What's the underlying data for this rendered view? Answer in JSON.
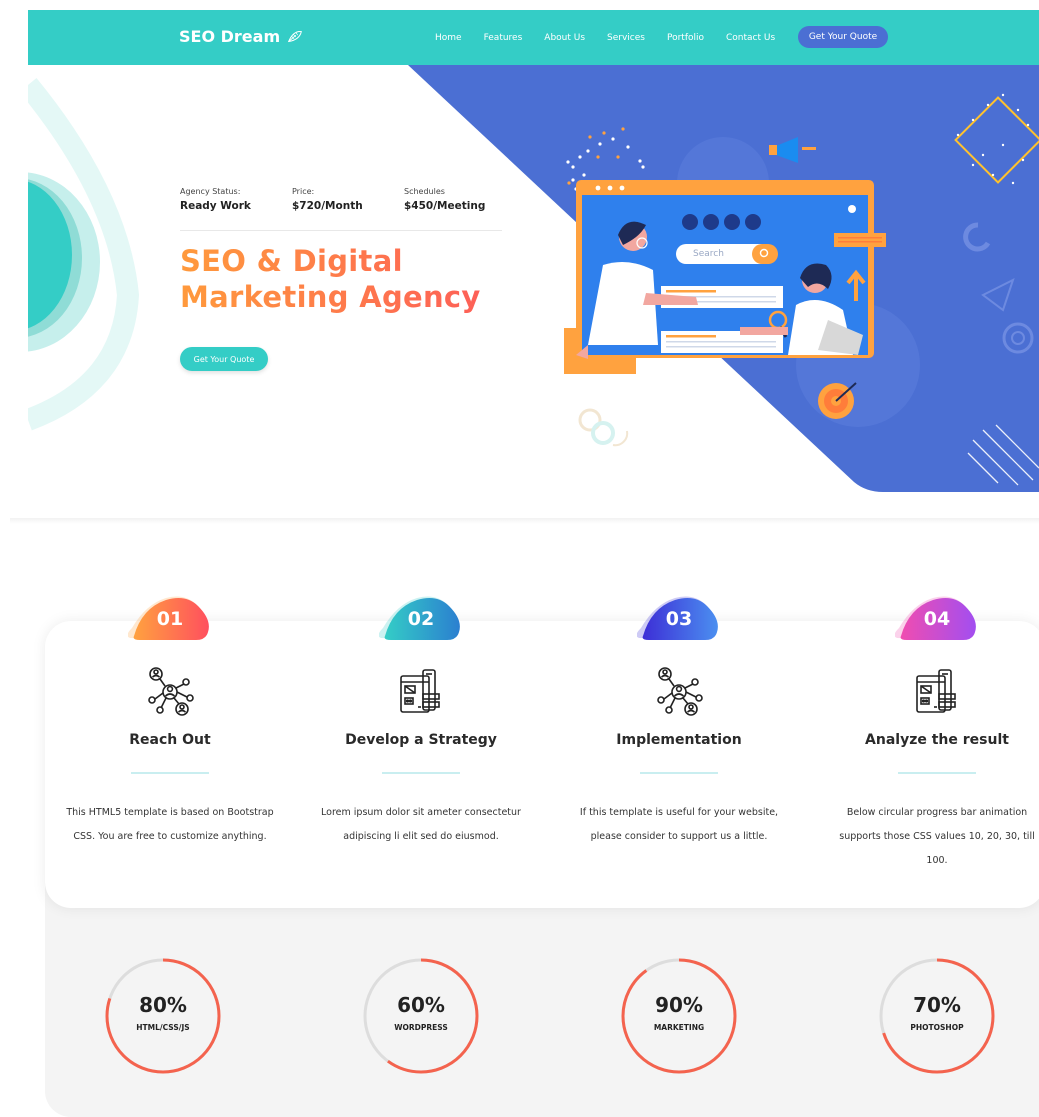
{
  "header": {
    "logo_text": "SEO Dream",
    "nav": [
      "Home",
      "Features",
      "About Us",
      "Services",
      "Portfolio",
      "Contact Us"
    ],
    "cta_label": "Get Your Quote"
  },
  "hero": {
    "stats": [
      {
        "label": "Agency Status:",
        "value": "Ready Work"
      },
      {
        "label": "Price:",
        "value": "$720/Month"
      },
      {
        "label": "Schedules",
        "value": "$450/Meeting"
      }
    ],
    "title_line1": "SEO & Digital",
    "title_line2": "Marketing Agency",
    "button_label": "Get Your Quote",
    "search_placeholder": "Search"
  },
  "features": [
    {
      "number": "01",
      "title": "Reach Out",
      "icon": "network-users-icon",
      "text": "This HTML5 template is based on Bootstrap CSS. You are free to customize anything.",
      "color_from": "#ffa23f",
      "color_to": "#ff4f5e"
    },
    {
      "number": "02",
      "title": "Develop a Strategy",
      "icon": "browser-strategy-icon",
      "text": "Lorem ipsum dolor sit ameter consectetur adipiscing li elit sed do eiusmod.",
      "color_from": "#34cdc6",
      "color_to": "#2b7fd0"
    },
    {
      "number": "03",
      "title": "Implementation",
      "icon": "network-users-icon",
      "text": "If this template is useful for your website, please consider to support us a little.",
      "color_from": "#3d2ed6",
      "color_to": "#4b8ff0"
    },
    {
      "number": "04",
      "title": "Analyze the result",
      "icon": "browser-strategy-icon",
      "text": "Below circular progress bar animation supports those CSS values 10, 20, 30, till 100.",
      "color_from": "#f04db0",
      "color_to": "#a24ef0"
    }
  ],
  "progress": [
    {
      "value": "80%",
      "label": "HTML/CSS/JS",
      "percent": 80
    },
    {
      "value": "60%",
      "label": "WORDPRESS",
      "percent": 60
    },
    {
      "value": "90%",
      "label": "MARKETING",
      "percent": 90
    },
    {
      "value": "70%",
      "label": "PHOTOSHOP",
      "percent": 70
    }
  ],
  "colors": {
    "primary": "#34cdc6",
    "accent_blue": "#4b6fd3",
    "progress_stroke": "#f4634e",
    "progress_track": "#dddddd"
  }
}
